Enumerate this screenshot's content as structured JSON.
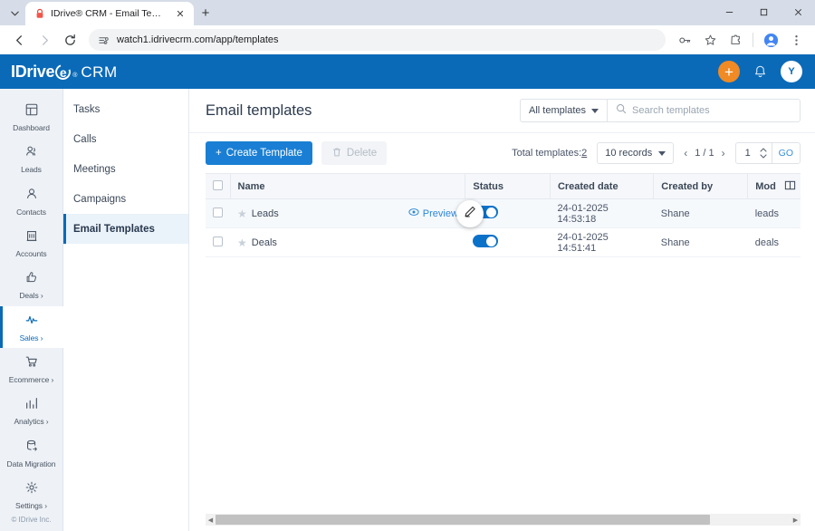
{
  "browser": {
    "tab": {
      "title": "IDrive® CRM - Email Templates",
      "favicon_name": "idrive-lock-favicon",
      "close_label": "✕"
    },
    "new_tab_label": "+",
    "tab_search_label": "⌄",
    "window_controls": {
      "minimize": "—",
      "maximize": "▢",
      "close": "✕"
    },
    "nav": {
      "back": "←",
      "forward": "→",
      "reload": "⟳"
    },
    "omnibox": {
      "url": "watch1.idrivecrm.com/app/templates",
      "site_icon_name": "site-settings-icon"
    },
    "toolbar_icons": {
      "password": "key-icon",
      "bookmark": "star-icon",
      "extensions": "puzzle-icon",
      "profile": "profile-icon",
      "menu": "three-dot-menu-icon"
    }
  },
  "app_header": {
    "logo": {
      "text_main": "IDrive",
      "mark": "e",
      "registered": "®",
      "suffix": "CRM"
    },
    "add_button_label": "+",
    "notifications_icon": "bell-icon",
    "avatar_initial": "Y"
  },
  "rail": {
    "items": [
      {
        "label": "Dashboard",
        "icon": "dashboard-icon",
        "active": false,
        "expandable": false
      },
      {
        "label": "Leads",
        "icon": "leads-icon",
        "active": false,
        "expandable": false
      },
      {
        "label": "Contacts",
        "icon": "contacts-icon",
        "active": false,
        "expandable": false
      },
      {
        "label": "Accounts",
        "icon": "accounts-icon",
        "active": false,
        "expandable": false
      },
      {
        "label": "Deals ›",
        "icon": "deals-icon",
        "active": false,
        "expandable": true
      },
      {
        "label": "Sales ›",
        "icon": "sales-icon",
        "active": true,
        "expandable": true
      },
      {
        "label": "Ecommerce ›",
        "icon": "ecommerce-icon",
        "active": false,
        "expandable": true
      },
      {
        "label": "Analytics ›",
        "icon": "analytics-icon",
        "active": false,
        "expandable": true
      },
      {
        "label": "Data Migration",
        "icon": "data-migration-icon",
        "active": false,
        "expandable": false
      },
      {
        "label": "Settings ›",
        "icon": "settings-gear-icon",
        "active": false,
        "expandable": true
      }
    ],
    "footer": "© IDrive Inc."
  },
  "subnav": {
    "items": [
      {
        "label": "Tasks",
        "active": false
      },
      {
        "label": "Calls",
        "active": false
      },
      {
        "label": "Meetings",
        "active": false
      },
      {
        "label": "Campaigns",
        "active": false
      },
      {
        "label": "Email Templates",
        "active": true
      }
    ]
  },
  "main": {
    "title": "Email templates",
    "filter_select": {
      "value": "All templates"
    },
    "search": {
      "placeholder": "Search templates",
      "value": ""
    },
    "toolbar": {
      "create_label": "Create Template",
      "create_plus": "+",
      "delete_label": "Delete",
      "delete_icon": "trash-icon"
    },
    "pagination": {
      "total_label": "Total templates:",
      "total_value": "2",
      "records_value": "10 records",
      "prev": "‹",
      "page_indicator": "1 / 1",
      "next": "›",
      "goto_value": "1",
      "go_label": "GO"
    },
    "table": {
      "columns": [
        "Name",
        "Status",
        "Created date",
        "Created by",
        "Mod"
      ],
      "column_settings_icon": "column-chooser-icon",
      "rows": [
        {
          "name": "Leads",
          "starred": false,
          "preview_label": "Preview",
          "preview_icon": "eye-icon",
          "show_preview": true,
          "show_edit_fab": true,
          "edit_icon": "pencil-icon",
          "status_on": true,
          "created_date": "24-01-2025 14:53:18",
          "created_by": "Shane",
          "mod": "leads"
        },
        {
          "name": "Deals",
          "starred": false,
          "preview_label": "Preview",
          "preview_icon": "eye-icon",
          "show_preview": false,
          "show_edit_fab": false,
          "edit_icon": "pencil-icon",
          "status_on": true,
          "created_date": "24-01-2025 14:51:41",
          "created_by": "Shane",
          "mod": "deals"
        }
      ]
    },
    "hscroll": {
      "left_arrow": "◀",
      "right_arrow": "▶"
    }
  },
  "colors": {
    "brand_blue": "#0a6ab8",
    "action_blue": "#1a7fd4",
    "accent_orange": "#f08a24",
    "toggle_on": "#0c72c9",
    "link_blue": "#2b87d8"
  }
}
